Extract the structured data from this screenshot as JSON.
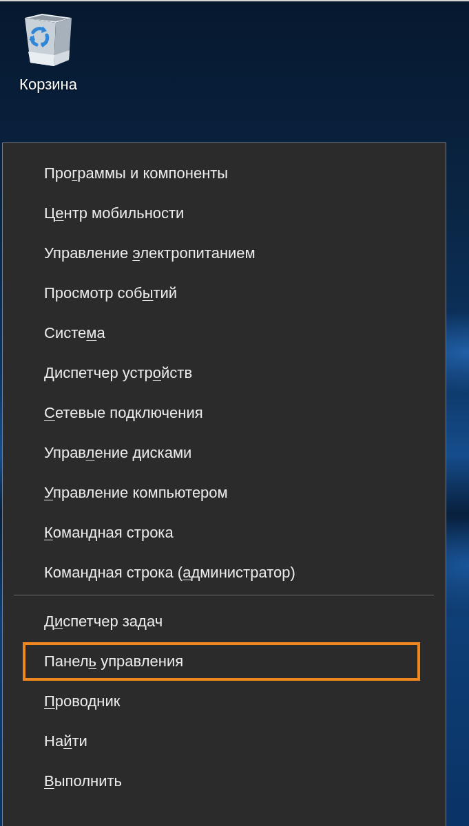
{
  "desktop": {
    "icons": [
      {
        "label": "Корзина"
      }
    ]
  },
  "context_menu": {
    "sections": [
      {
        "items": [
          {
            "label": {
              "before": "Про",
              "access_key": "г",
              "after": "раммы и компоненты"
            },
            "highlighted": false
          },
          {
            "label": {
              "before": "Ц",
              "access_key": "е",
              "after": "нтр мобильности"
            },
            "highlighted": false
          },
          {
            "label": {
              "before": "Управление ",
              "access_key": "э",
              "after": "лектропитанием"
            },
            "highlighted": false
          },
          {
            "label": {
              "before": "Просмотр соб",
              "access_key": "ы",
              "after": "тий"
            },
            "highlighted": false
          },
          {
            "label": {
              "before": "Систе",
              "access_key": "м",
              "after": "а"
            },
            "highlighted": false
          },
          {
            "label": {
              "before": "Диспетчер устр",
              "access_key": "о",
              "after": "йств"
            },
            "highlighted": false
          },
          {
            "label": {
              "access_key": "С",
              "after": "етевые подключения"
            },
            "highlighted": false
          },
          {
            "label": {
              "before": "Управ",
              "access_key": "л",
              "after": "ение дисками"
            },
            "highlighted": false
          },
          {
            "label": {
              "access_key": "У",
              "after": "правление компьютером"
            },
            "highlighted": false
          },
          {
            "label": {
              "access_key": "К",
              "after": "омандная строка"
            },
            "highlighted": false
          },
          {
            "label": {
              "before": "Командная строка (",
              "access_key": "а",
              "after": "дминистратор)"
            },
            "highlighted": false
          }
        ]
      },
      {
        "items": [
          {
            "label": {
              "before": "Д",
              "access_key": "и",
              "after": "спетчер задач"
            },
            "highlighted": false
          },
          {
            "label": {
              "before": "Панел",
              "access_key": "ь",
              "after": " управления"
            },
            "highlighted": true
          },
          {
            "label": {
              "access_key": "П",
              "after": "роводник"
            },
            "highlighted": false
          },
          {
            "label": {
              "before": "На",
              "access_key": "й",
              "after": "ти"
            },
            "highlighted": false
          },
          {
            "label": {
              "access_key": "В",
              "after": "ыполнить"
            },
            "highlighted": false
          }
        ]
      }
    ]
  }
}
